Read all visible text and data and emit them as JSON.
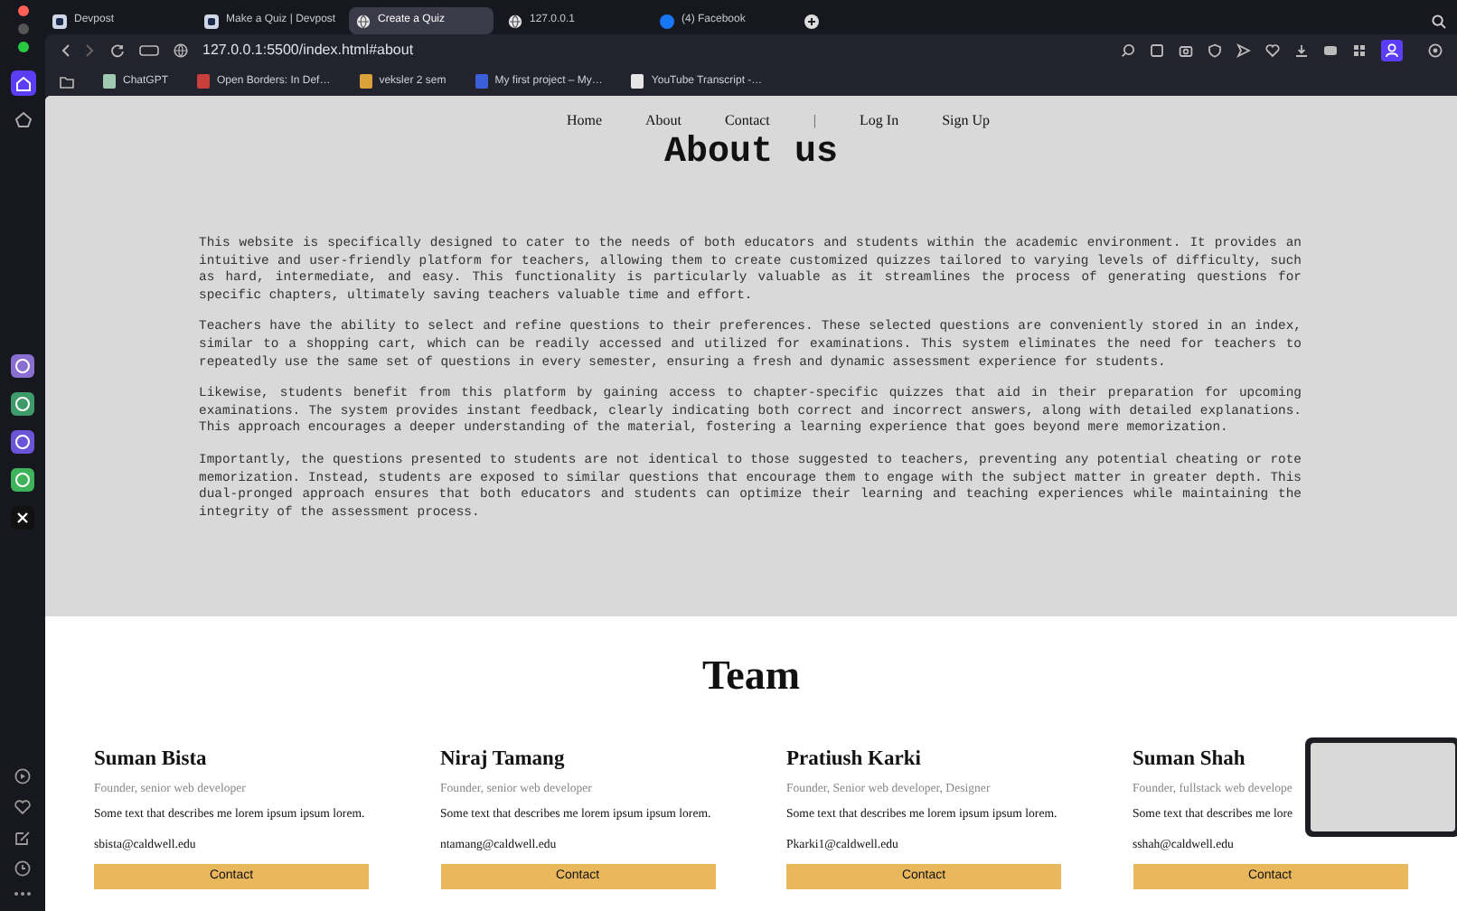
{
  "browser": {
    "tabs": [
      {
        "title": "Devpost",
        "kind": "square",
        "selected": false
      },
      {
        "title": "Make a Quiz | Devpost",
        "kind": "square",
        "selected": false
      },
      {
        "title": "Create a Quiz",
        "kind": "globe",
        "selected": true
      },
      {
        "title": "127.0.0.1",
        "kind": "globe",
        "selected": false
      },
      {
        "title": "(4) Facebook",
        "kind": "circle",
        "selected": false
      }
    ],
    "address": "127.0.0.1:5500/index.html#about",
    "bookmarks": [
      {
        "title": "ChatGPT",
        "color": "#9fc9b0"
      },
      {
        "title": "Open Borders: In Def…",
        "color": "#c9403a"
      },
      {
        "title": "veksler 2 sem",
        "color": "#d9a23a"
      },
      {
        "title": "My first project – My…",
        "color": "#3b5fd9"
      },
      {
        "title": "YouTube Transcript -…",
        "color": "#e6e6e6"
      }
    ]
  },
  "nav": [
    {
      "label": "Home",
      "kind": "link"
    },
    {
      "label": "About",
      "kind": "link"
    },
    {
      "label": "Contact",
      "kind": "link"
    },
    {
      "label": "|",
      "kind": "separator"
    },
    {
      "label": "Log In",
      "kind": "link"
    },
    {
      "label": "Sign Up",
      "kind": "link"
    }
  ],
  "about": {
    "title": "About us",
    "paragraphs": [
      "This website is specifically designed to cater to the needs of both educators and students within the academic environment. It provides an intuitive and user-friendly platform for teachers, allowing them to create customized quizzes tailored to varying levels of difficulty, such as hard, intermediate, and easy. This functionality is particularly valuable as it streamlines the process of generating questions for specific chapters, ultimately saving teachers valuable time and effort.",
      "Teachers have the ability to select and refine questions to their preferences. These selected questions are conveniently stored in an index, similar to a shopping cart, which can be readily accessed and utilized for examinations. This system eliminates the need for teachers to repeatedly use the same set of questions in every semester, ensuring a fresh and dynamic assessment experience for students.",
      "Likewise, students benefit from this platform by gaining access to chapter-specific quizzes that aid in their preparation for upcoming examinations. The system provides instant feedback, clearly indicating both correct and incorrect answers, along with detailed explanations. This approach encourages a deeper understanding of the material, fostering a learning experience that goes beyond mere memorization.",
      "Importantly, the questions presented to students are not identical to those suggested to teachers, preventing any potential cheating or rote memorization. Instead, students are exposed to similar questions that encourage them to engage with the subject matter in greater depth. This dual-pronged approach ensures that both educators and students can optimize their learning and teaching experiences while maintaining the integrity of the assessment process."
    ]
  },
  "team": {
    "title": "Team",
    "members": [
      {
        "name": "Suman Bista",
        "role": "Founder, senior web developer",
        "description": "Some text that describes me lorem ipsum ipsum lorem.",
        "email": "sbista@caldwell.edu",
        "button": "Contact"
      },
      {
        "name": "Niraj Tamang",
        "role": "Founder, senior web developer",
        "description": "Some text that describes me lorem ipsum ipsum lorem.",
        "email": "ntamang@caldwell.edu",
        "button": "Contact"
      },
      {
        "name": "Pratiush Karki",
        "role": "Founder, Senior web developer, Designer",
        "description": "Some text that describes me lorem ipsum ipsum lorem.",
        "email": "Pkarki1@caldwell.edu",
        "button": "Contact"
      },
      {
        "name": "Suman Shah",
        "role": "Founder, fullstack web develope",
        "description": "Some text that describes me lore",
        "email": "sshah@caldwell.edu",
        "button": "Contact"
      }
    ]
  }
}
